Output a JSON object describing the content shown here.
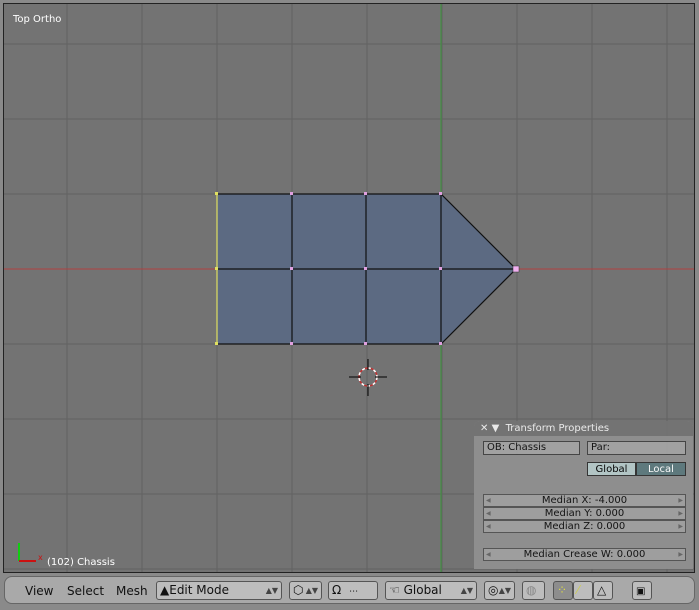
{
  "viewport": {
    "title": "Top Ortho",
    "object_info": "(102) Chassis"
  },
  "transform_panel": {
    "title": "Transform Properties",
    "object_field": "OB: Chassis",
    "parent_field": "Par:",
    "global_label": "Global",
    "local_label": "Local",
    "active_space": "Local",
    "median_x": "Median X: -4.000",
    "median_y": "Median Y: 0.000",
    "median_z": "Median Z: 0.000",
    "median_crease": "Median Crease W: 0.000"
  },
  "header": {
    "menus": [
      "View",
      "Select",
      "Mesh"
    ],
    "mode": "Edit Mode",
    "orientation": "Global"
  },
  "colors": {
    "viewport_bg": "#737373",
    "mesh_face": "#5c6a82",
    "x_axis": "#b04040",
    "y_axis": "#3a9a3a",
    "selected_edge": "#e0e060"
  }
}
